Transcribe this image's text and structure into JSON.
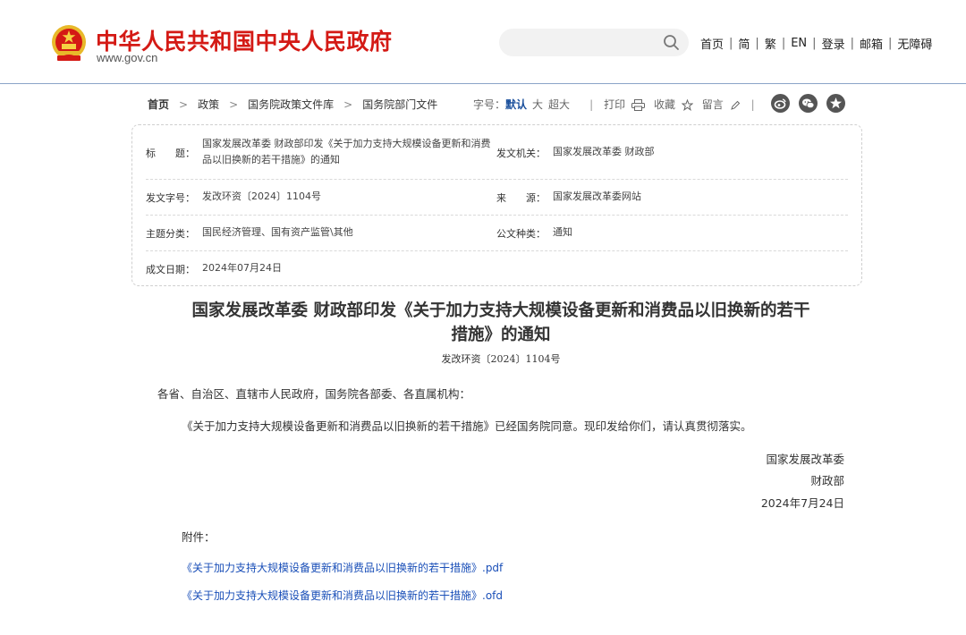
{
  "header": {
    "site_title": "中华人民共和国中央人民政府",
    "site_domain": "www.gov.cn",
    "search_placeholder": "",
    "nav": [
      "首页",
      "简",
      "繁",
      "EN",
      "登录",
      "邮箱",
      "无障碍"
    ],
    "nav_separator": "|"
  },
  "breadcrumb": [
    "首页",
    "政策",
    "国务院政策文件库",
    "国务院部门文件"
  ],
  "tools": {
    "font_size_label": "字号：",
    "font_sizes": [
      "默认",
      "大",
      "超大"
    ],
    "print": "打印",
    "favorite": "收藏",
    "comment": "留言",
    "separator": "|"
  },
  "info": {
    "title_label": "标　　题：",
    "title_value": "国家发展改革委 财政部印发《关于加力支持大规模设备更新和消费品以旧换新的若干措施》的通知",
    "issuer_label": "发文机关：",
    "issuer_value": "国家发展改革委 财政部",
    "doc_no_label": "发文字号：",
    "doc_no_value": "发改环资〔2024〕1104号",
    "source_label": "来　　源：",
    "source_value": "国家发展改革委网站",
    "topic_label": "主题分类：",
    "topic_value": "国民经济管理、国有资产监管\\其他",
    "type_label": "公文种类：",
    "type_value": "通知",
    "date_label": "成文日期：",
    "date_value": "2024年07月24日"
  },
  "article": {
    "title_line1": "国家发展改革委 财政部印发《关于加力支持大规模设备更新和消费品以旧换新的若干",
    "title_line2": "措施》的通知",
    "doc_no": "发改环资〔2024〕1104号",
    "salutation": "各省、自治区、直辖市人民政府，国务院各部委、各直属机构：",
    "body": "《关于加力支持大规模设备更新和消费品以旧换新的若干措施》已经国务院同意。现印发给你们，请认真贯彻落实。",
    "sign1": "国家发展改革委",
    "sign2": "财政部",
    "sign_date": "2024年7月24日",
    "attachments_label": "附件：",
    "attachments": [
      "《关于加力支持大规模设备更新和消费品以旧换新的若干措施》.pdf",
      "《关于加力支持大规模设备更新和消费品以旧换新的若干措施》.ofd"
    ]
  },
  "colors": {
    "title_red": "#d41a15",
    "link_blue": "#1a4fb8",
    "selected_blue": "#1a4f9c",
    "header_rule": "#8aa4c8"
  },
  "icons": [
    "national-emblem-icon",
    "search-icon",
    "printer-icon",
    "star-icon",
    "pencil-icon",
    "weibo-icon",
    "wechat-icon",
    "favorite-star-icon"
  ]
}
